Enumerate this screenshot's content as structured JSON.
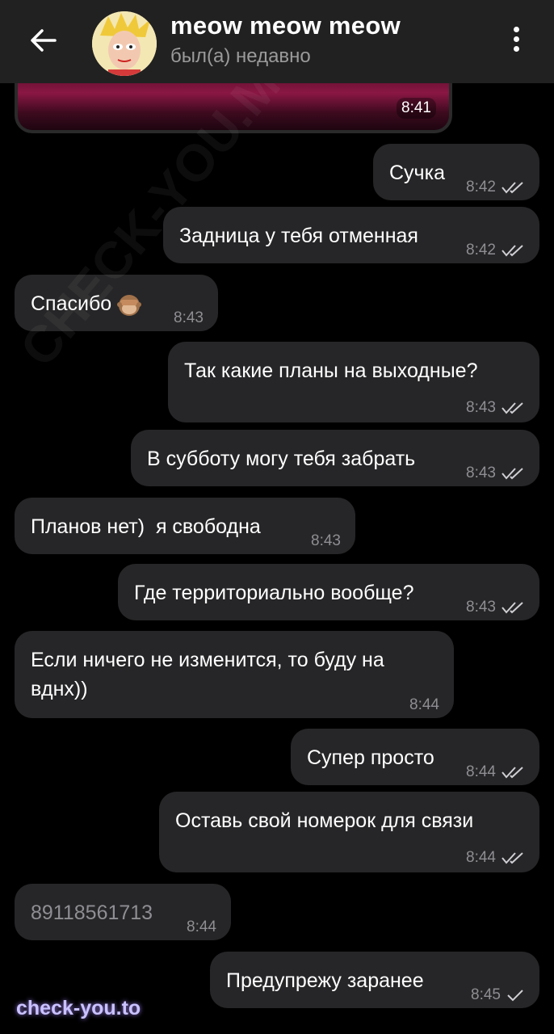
{
  "header": {
    "title": "meow meow meow",
    "status": "был(а) недавно"
  },
  "media": {
    "time": "8:41"
  },
  "messages": [
    {
      "text": "Сучка",
      "time": "8:42",
      "out": true,
      "read": true
    },
    {
      "text": "Задница у тебя отменная",
      "time": "8:42",
      "out": true,
      "read": true
    },
    {
      "text": "Спасибо",
      "time": "8:43",
      "out": false,
      "emoji": "see-no-evil-monkey"
    },
    {
      "text": "Так какие планы на выходные?",
      "time": "8:43",
      "out": true,
      "read": true
    },
    {
      "text": "В субботу могу тебя забрать",
      "time": "8:43",
      "out": true,
      "read": true
    },
    {
      "text": "Планов нет)  я свободна",
      "time": "8:43",
      "out": false
    },
    {
      "text": "Где территориально вообще?",
      "time": "8:43",
      "out": true,
      "read": true
    },
    {
      "text_line1": "Если ничего не изменится, то буду на",
      "text_line2": "вднх))",
      "time": "8:44",
      "out": false
    },
    {
      "text": "Супер просто",
      "time": "8:44",
      "out": true,
      "read": true
    },
    {
      "text": "Оставь свой номерок для связи",
      "time": "8:44",
      "out": true,
      "read": true
    },
    {
      "text": "89118561713",
      "time": "8:44",
      "out": false
    },
    {
      "text": "Предупрежу заранее",
      "time": "8:45",
      "out": true,
      "read": false
    }
  ],
  "watermark": {
    "text": "CHECK-YOU.ME",
    "logo": "check-you.to"
  },
  "colors": {
    "background": "#000000",
    "header": "#212121",
    "bubble": "#262628",
    "meta": "#8e8e93"
  }
}
